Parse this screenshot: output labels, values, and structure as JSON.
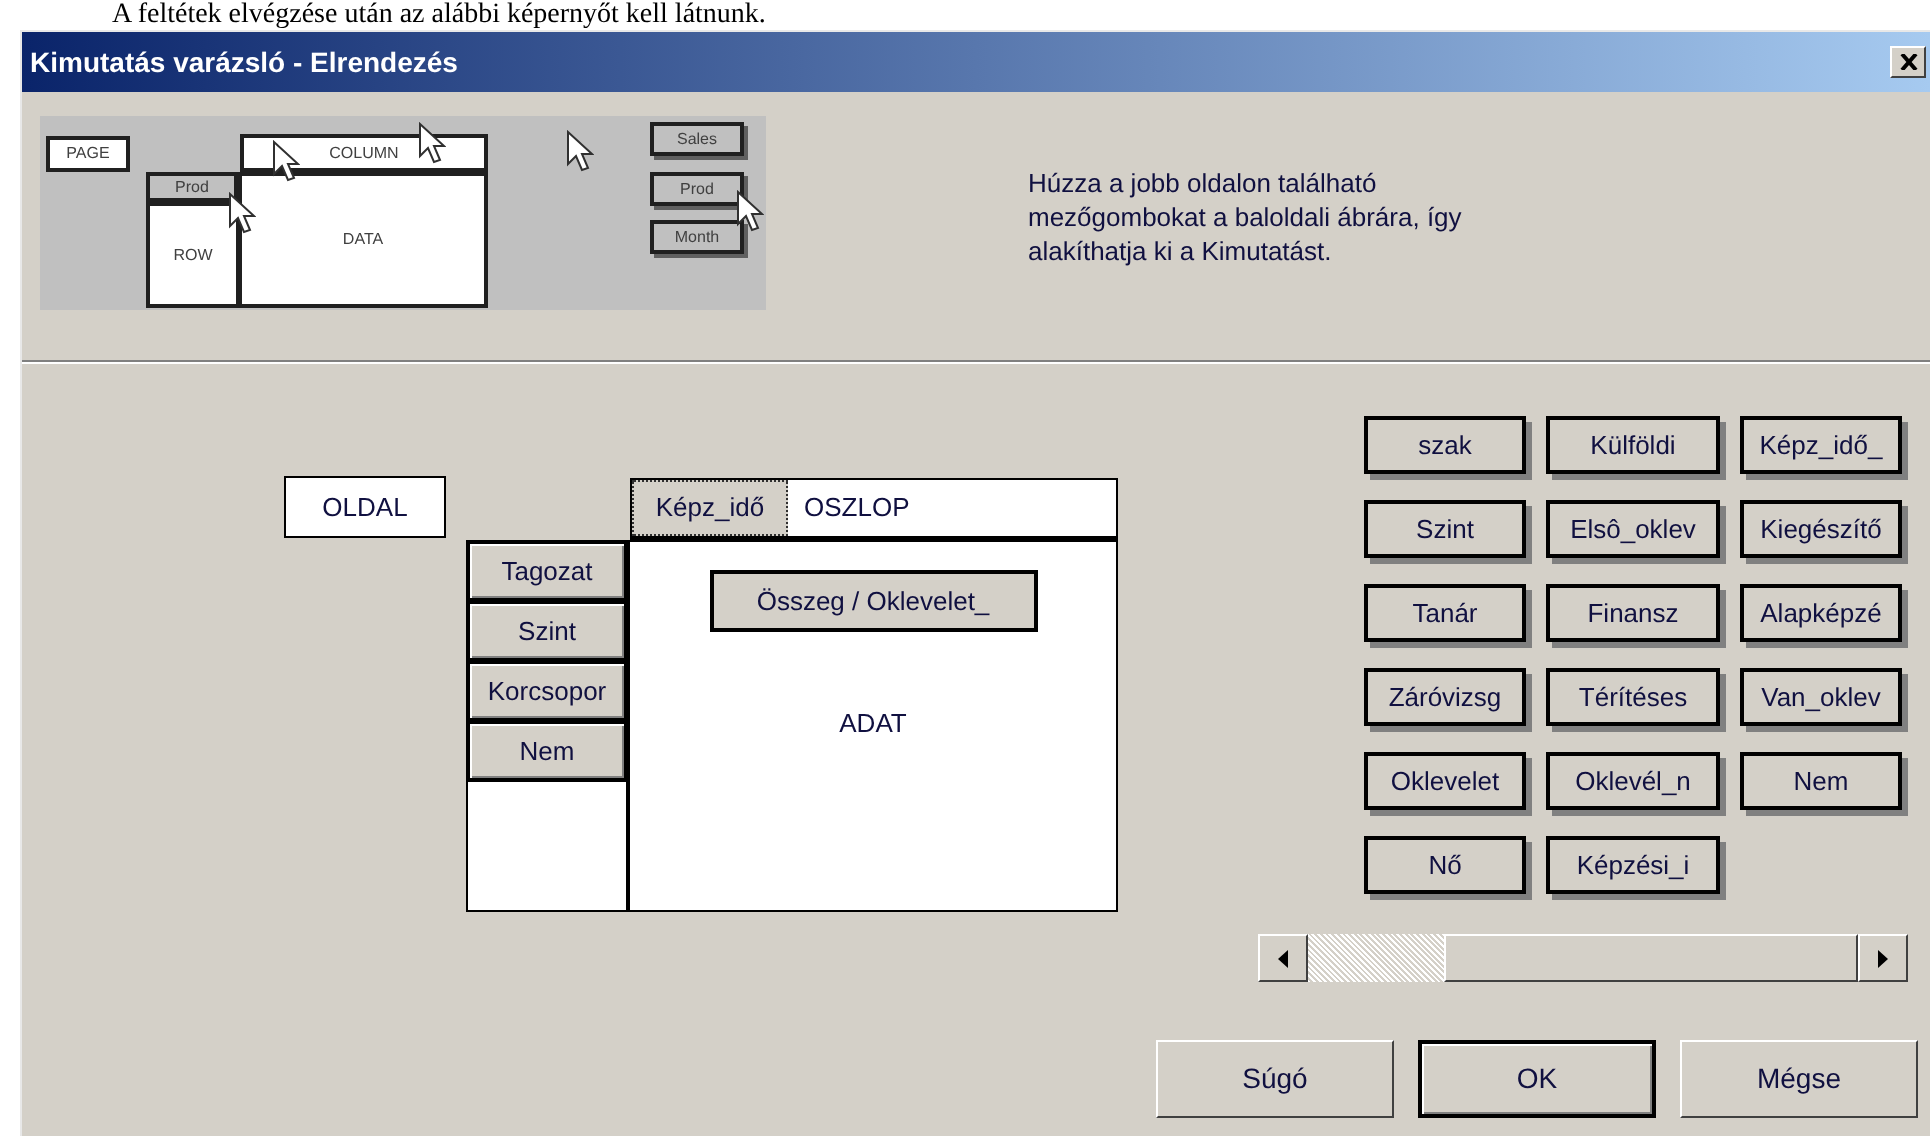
{
  "caption": "A feltétek elvégzése után az alábbi képernyőt kell látnunk.",
  "window": {
    "title": "Kimutatás varázsló - Elrendezés"
  },
  "preview": {
    "labels": [
      {
        "kind": "page",
        "text": "PAGE"
      },
      {
        "kind": "column",
        "text": "COLUMN"
      },
      {
        "kind": "rowfield",
        "text": "Prod"
      },
      {
        "kind": "row",
        "text": "ROW"
      },
      {
        "kind": "data",
        "text": "DATA"
      },
      {
        "kind": "field1",
        "text": "Sales"
      },
      {
        "kind": "field2",
        "text": "Prod"
      },
      {
        "kind": "field3",
        "text": "Month"
      }
    ]
  },
  "instructions": "Húzza a jobb oldalon található mezőgombokat a baloldali ábrára, így alakíthatja ki a Kimutatást.",
  "layout": {
    "page_label": "OLDAL",
    "column_label": "OSZLOP",
    "data_label": "ADAT",
    "column_fields": [
      {
        "label": "Képz_idő",
        "focused": true
      }
    ],
    "row_fields": [
      {
        "label": "Tagozat",
        "focused": false
      },
      {
        "label": "Szint",
        "focused": false
      },
      {
        "label": "Korcsopor",
        "focused": false
      },
      {
        "label": "Nem",
        "focused": false
      }
    ],
    "data_fields": [
      {
        "label": "Összeg / Oklevelet_",
        "focused": false
      }
    ]
  },
  "fields": [
    "szak",
    "Külföldi",
    "Képz_idő_",
    "Szint",
    "Elsô_oklev",
    "Kiegészítő",
    "Tanár",
    "Finansz",
    "Alapképzé",
    "Záróvizsg",
    "Térítéses",
    "Van_oklev",
    "Oklevelet",
    "Oklevél_n",
    "Nem",
    "Nő",
    "Képzési_i"
  ],
  "buttons": [
    {
      "label": "Súgó",
      "default": false
    },
    {
      "label": "OK",
      "default": true
    },
    {
      "label": "Mégse",
      "default": false
    }
  ]
}
